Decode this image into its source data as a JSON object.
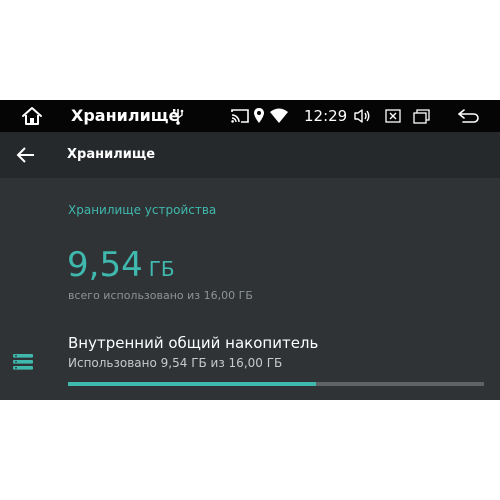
{
  "status_bar": {
    "app_title": "Хранилище",
    "time": "12:29"
  },
  "app_bar": {
    "title": "Хранилище"
  },
  "device_storage": {
    "section_header": "Хранилище устройства",
    "used_value": "9,54",
    "used_unit": "ГБ",
    "total_caption": "всего использовано из 16,00 ГБ"
  },
  "internal_storage": {
    "title": "Внутренний общий накопитель",
    "usage_text": "Использовано 9,54 ГБ из 16,00 ГБ",
    "used_fraction": 0.596
  },
  "colors": {
    "accent": "#3fb8ad",
    "status_bar_bg": "#050505",
    "app_bar_bg": "#26292b",
    "content_bg": "#2f3336"
  },
  "icons": {
    "home": "home-icon",
    "usb": "usb-icon",
    "cast": "cast-icon",
    "location": "location-icon",
    "wifi": "wifi-icon",
    "volume": "volume-icon",
    "close_window": "close-window-icon",
    "recent_apps": "recent-apps-icon",
    "back_nav": "back-nav-icon",
    "back_arrow": "arrow-back-icon",
    "storage": "storage-icon"
  }
}
